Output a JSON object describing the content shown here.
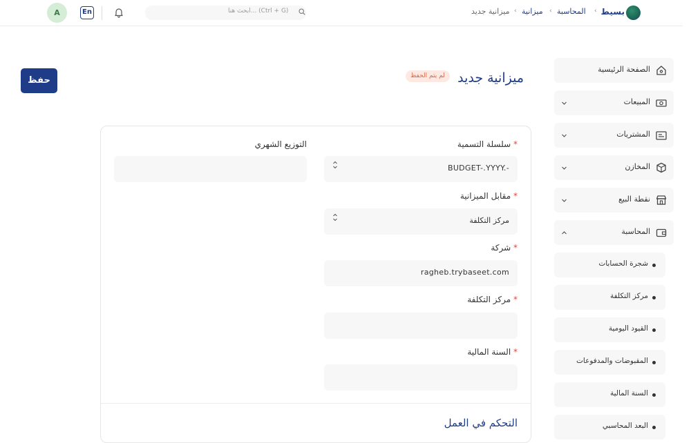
{
  "header": {
    "brand": "بسيط",
    "breadcrumbs": [
      "المحاسبة",
      "ميزانية",
      "ميزانية جديد"
    ],
    "search_placeholder": "ابحث هنا... (Ctrl + G)",
    "lang_label": "En",
    "avatar_initial": "A"
  },
  "sidebar": {
    "items": [
      {
        "label": "الصفحة الرئيسية",
        "icon": "home-icon"
      },
      {
        "label": "المبيعات",
        "icon": "cash-icon"
      },
      {
        "label": "المشتريات",
        "icon": "purchases-icon"
      },
      {
        "label": "المخازن",
        "icon": "box-icon"
      },
      {
        "label": "نقطة البيع",
        "icon": "store-icon"
      },
      {
        "label": "المحاسبة",
        "icon": "wallet-icon"
      }
    ],
    "sub_items": [
      {
        "label": "شجرة الحسابات"
      },
      {
        "label": "مركز التكلفة"
      },
      {
        "label": "القيود اليومية"
      },
      {
        "label": "المقبوضات والمدفوعات"
      },
      {
        "label": "السنة المالية"
      },
      {
        "label": "البعد المحاسبي"
      }
    ]
  },
  "page": {
    "title": "ميزانية جديد",
    "status_badge": "لم يتم الحفظ",
    "save_label": "حفظ"
  },
  "form": {
    "naming_series": {
      "label": "سلسلة التسمية",
      "required": "*",
      "value": "BUDGET-.YYYY.-"
    },
    "budget_against": {
      "label": "مقابل الميزانية",
      "required": "*",
      "value": "مركز التكلفة"
    },
    "company": {
      "label": "شركة",
      "required": "*",
      "value": "ragheb.trybaseet.com"
    },
    "cost_center": {
      "label": "مركز التكلفة",
      "required": "*",
      "value": ""
    },
    "fiscal_year": {
      "label": "السنة المالية",
      "required": "*",
      "value": ""
    },
    "monthly_distribution": {
      "label": "التوزيع الشهري",
      "value": ""
    },
    "section_title": "التحكم في العمل"
  },
  "colors": {
    "primary": "#1f3c88",
    "badge_bg": "#fde8e2",
    "badge_text": "#e2633e",
    "required": "#e2453c"
  }
}
